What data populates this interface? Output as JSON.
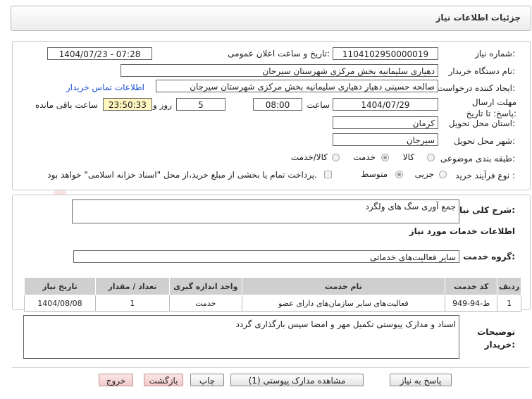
{
  "window": {
    "title": "جزئیات اطلاعات نیاز"
  },
  "watermark": {
    "brand": "AriaTender.net"
  },
  "form": {
    "need_number_label": "شماره نیاز:",
    "need_number": "1104102950000019",
    "announce_label": "تاریخ و ساعت اعلان عمومی:",
    "announce_value": "1404/07/23 - 07:28",
    "buyer_org_label": "نام دستگاه خریدار:",
    "buyer_org": "دهیاری سلیمانیه بخش مرکزی شهرستان سیرجان",
    "creator_label": "ایجاد کننده درخواست:",
    "creator": "صالحه حسینی دهیار دهیاری سلیمانیه بخش مرکزی شهرستان سیرجان",
    "contact_link": "اطلاعات تماس خریدار",
    "deadline_label": "مهلت ارسال پاسخ: تا تاریخ:",
    "deadline_date": "1404/07/29",
    "time_label": "ساعت",
    "deadline_time": "08:00",
    "days_value": "5",
    "days_label": "روز و",
    "remaining_time": "23:50:33",
    "remaining_label": "ساعت باقی مانده",
    "province_label": "استان محل تحویل:",
    "province": "کرمان",
    "city_label": "شهر محل تحویل:",
    "city": "سیرجان",
    "category_label": "طبقه بندی موضوعی:",
    "category_options": [
      "کالا",
      "خدمت",
      "کالا/خدمت"
    ],
    "category_selected": "خدمت",
    "process_label": "نوع فرآیند خرید :",
    "process_options": [
      "جزیی",
      "متوسط"
    ],
    "process_selected": "متوسط",
    "payment_note": "پرداخت تمام یا بخشی از مبلغ خرید،از محل \"اسناد خزانه اسلامی\" خواهد بود."
  },
  "description": {
    "label": "شرح کلی نیاز:",
    "value": "جمع آوری سگ های ولگرد"
  },
  "services": {
    "section_title": "اطلاعات خدمات مورد نیاز",
    "group_label": "گروه خدمت:",
    "group_value": "سایر فعالیت‌های خدماتی",
    "columns": [
      "ردیف",
      "کد خدمت",
      "نام خدمت",
      "واحد اندازه گیری",
      "تعداد / مقدار",
      "تاریخ نیاز"
    ],
    "rows": [
      [
        "1",
        "ط-94-949",
        "فعالیت‌های سایر سازمان‌های دارای عضو",
        "خدمت",
        "1",
        "1404/08/08"
      ]
    ]
  },
  "buyer_notes": {
    "label": "توضیحات خریدار:",
    "value": "اسناد و مدارک پیوستی تکمیل مهر و امضا سپس بارگذاری گردد"
  },
  "buttons": {
    "reply": "پاسخ به نیاز",
    "attachments": "مشاهده مدارک پیوستی (1)",
    "print": "چاپ",
    "back": "بازگشت",
    "exit": "خروج"
  },
  "colors": {
    "highlight": "#fff6c0",
    "link": "#1a4fd6",
    "table_header": "#cfcfcf"
  }
}
